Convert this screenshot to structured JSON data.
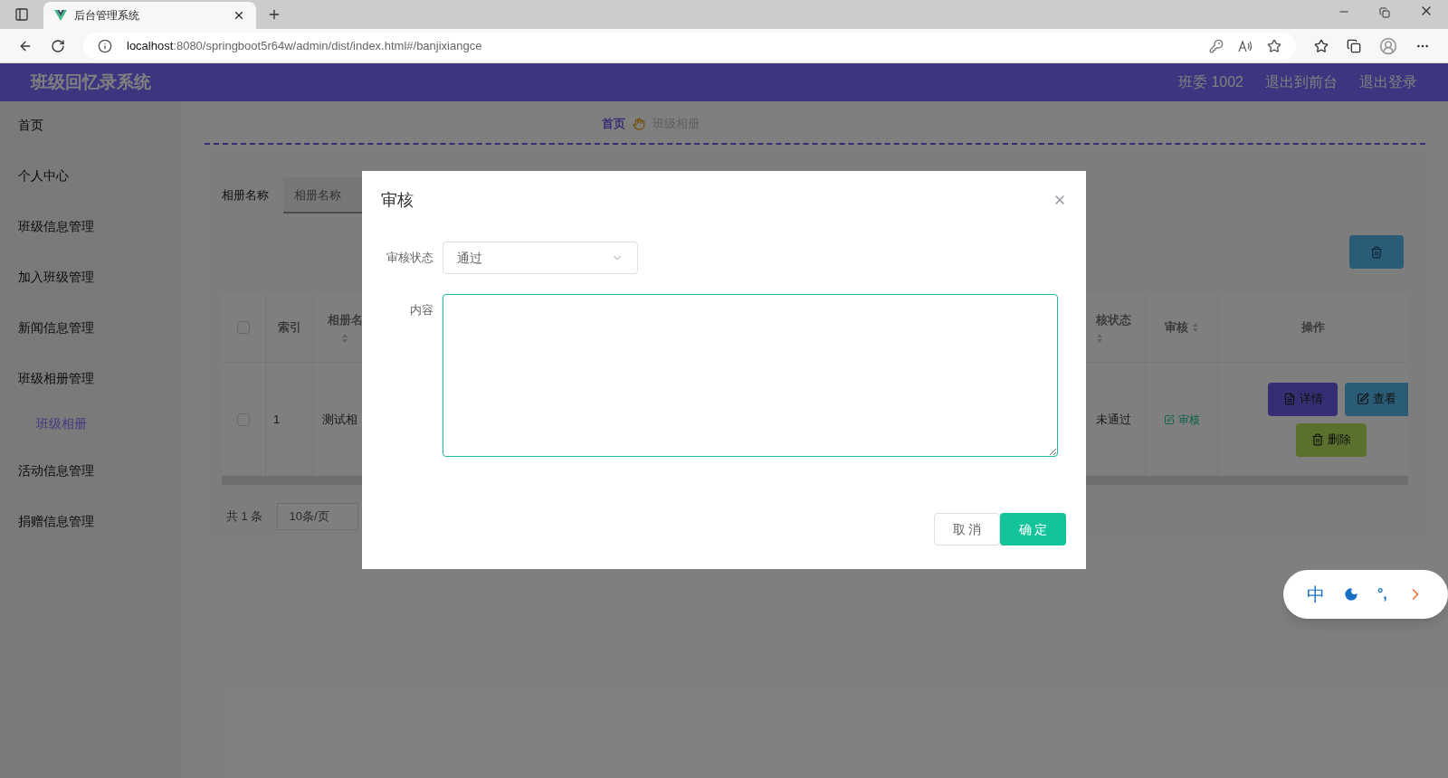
{
  "browser": {
    "tab_title": "后台管理系统",
    "address_host": "localhost",
    "address_path": ":8080/springboot5r64w/admin/dist/index.html#/banjixiangce"
  },
  "header": {
    "title": "班级回忆录系统",
    "links": [
      "班委 1002",
      "退出到前台",
      "退出登录"
    ]
  },
  "sidebar": {
    "items": [
      {
        "label": "首页",
        "selected": false
      },
      {
        "label": "个人中心",
        "selected": false
      },
      {
        "label": "班级信息管理",
        "selected": false
      },
      {
        "label": "加入班级管理",
        "selected": false
      },
      {
        "label": "新闻信息管理",
        "selected": false
      },
      {
        "label": "班级相册管理",
        "selected": false,
        "children": [
          {
            "label": "班级相册",
            "selected": true
          }
        ]
      },
      {
        "label": "活动信息管理",
        "selected": false
      },
      {
        "label": "捐赠信息管理",
        "selected": false
      }
    ]
  },
  "breadcrumb": [
    "首页",
    "班级相册"
  ],
  "search": {
    "label": "相册名称",
    "placeholder": "相册名称"
  },
  "table": {
    "all_checked": false,
    "left_columns": [
      "索引",
      "相册名"
    ],
    "right_columns": [
      "核状态",
      "审核",
      "操作"
    ],
    "rows": [
      {
        "checked": false,
        "index": "1",
        "name": "测试相",
        "status": "未通过",
        "review": "审核",
        "actions": [
          "详情",
          "查看",
          "删除"
        ]
      }
    ]
  },
  "pagination": {
    "total": "共 1 条",
    "page_size": "10条/页"
  },
  "dialog": {
    "title": "审核",
    "status_label": "审核状态",
    "status_value": "通过",
    "content_label": "内容",
    "buttons": [
      {
        "label": "取 消",
        "kind": "default"
      },
      {
        "label": "确 定",
        "kind": "primary"
      }
    ]
  },
  "ime": {
    "items": [
      "中",
      "°,"
    ]
  }
}
